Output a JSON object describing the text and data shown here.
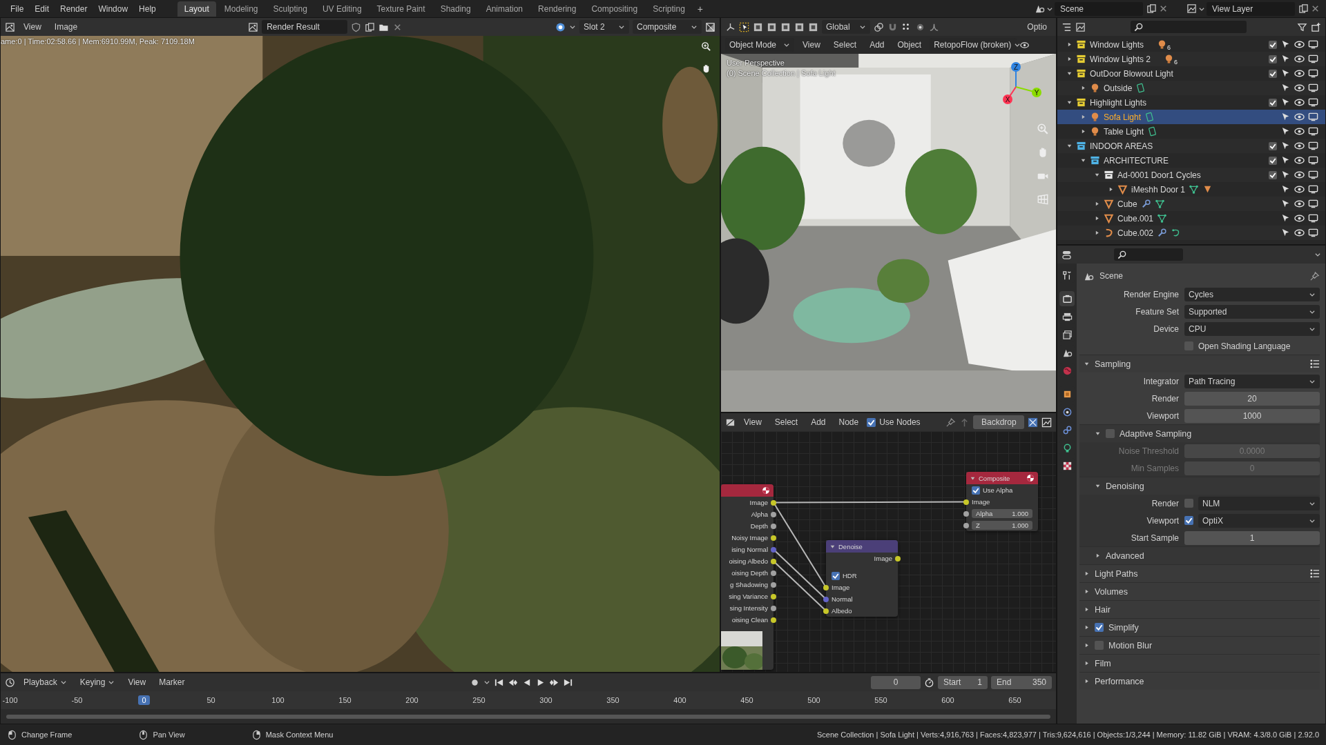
{
  "top_bar": {
    "menus": [
      "File",
      "Edit",
      "Render",
      "Window",
      "Help"
    ],
    "workspaces": [
      {
        "label": "Layout",
        "selected": true
      },
      {
        "label": "Modeling",
        "selected": false
      },
      {
        "label": "Sculpting",
        "selected": false
      },
      {
        "label": "UV Editing",
        "selected": false
      },
      {
        "label": "Texture Paint",
        "selected": false
      },
      {
        "label": "Shading",
        "selected": false
      },
      {
        "label": "Animation",
        "selected": false
      },
      {
        "label": "Rendering",
        "selected": false
      },
      {
        "label": "Compositing",
        "selected": false
      },
      {
        "label": "Scripting",
        "selected": false
      }
    ],
    "add_workspace": "+",
    "scene": "Scene",
    "view_layer": "View Layer"
  },
  "image_editor": {
    "menus": [
      "View",
      "Image"
    ],
    "image": "Render Result",
    "slot": "Slot 2",
    "layer": "Composite",
    "render_info": "ame:0 | Time:02:58.66 | Mem:6910.99M, Peak: 7109.18M"
  },
  "viewport": {
    "transform": "Global",
    "options": "Optio",
    "mode": "Object Mode",
    "menus": [
      "View",
      "Select",
      "Add",
      "Object"
    ],
    "addon_menu": "RetopoFlow (broken)",
    "view_name": "User Perspective",
    "context": "(0) Scene Collection | Sofa Light",
    "axes": [
      {
        "label": "Z",
        "color": "#2f83e0"
      },
      {
        "label": "Y",
        "color": "#8bdc00"
      },
      {
        "label": "X",
        "color": "#ff3352"
      }
    ]
  },
  "node_editor": {
    "menus": [
      "View",
      "Select",
      "Add",
      "Node"
    ],
    "use_nodes": {
      "label": "Use Nodes",
      "checked": true
    },
    "backdrop": "Backdrop",
    "nodes": [
      {
        "kind": "input",
        "preview": true,
        "rows": [
          {
            "kind": "output",
            "label": "Image",
            "color": "#c7c729"
          },
          {
            "kind": "output",
            "label": "Alpha",
            "color": "#a1a1a1"
          },
          {
            "kind": "output",
            "label": "Depth",
            "color": "#a1a1a1"
          },
          {
            "kind": "output",
            "label": "Noisy Image",
            "color": "#c7c729"
          },
          {
            "kind": "output",
            "label": "ising Normal",
            "color": "#6363c7"
          },
          {
            "kind": "output",
            "label": "oising Albedo",
            "color": "#c7c729"
          },
          {
            "kind": "output",
            "label": "oising Depth",
            "color": "#a1a1a1"
          },
          {
            "kind": "output",
            "label": "g Shadowing",
            "color": "#a1a1a1"
          },
          {
            "kind": "output",
            "label": "sing Variance",
            "color": "#c7c729"
          },
          {
            "kind": "output",
            "label": "sing Intensity",
            "color": "#a1a1a1"
          },
          {
            "kind": "output",
            "label": "oising Clean",
            "color": "#c7c729"
          }
        ]
      },
      {
        "kind": "filter",
        "title": "Denoise",
        "rows": [
          {
            "kind": "output",
            "label": "Image",
            "color": "#c7c729"
          },
          {
            "kind": "checkbox",
            "label": "HDR",
            "checked": true
          },
          {
            "kind": "input",
            "label": "Image",
            "color": "#c7c729",
            "linked": true
          },
          {
            "kind": "input",
            "label": "Normal",
            "color": "#6363c7",
            "linked": true
          },
          {
            "kind": "input",
            "label": "Albedo",
            "color": "#c7c729",
            "linked": true
          }
        ]
      },
      {
        "kind": "output",
        "title": "Composite",
        "rows": [
          {
            "kind": "checkbox",
            "label": "Use Alpha",
            "checked": true
          },
          {
            "kind": "input",
            "label": "Image",
            "color": "#c7c729",
            "linked": true
          },
          {
            "kind": "value",
            "label": "Alpha",
            "value": "1.000",
            "color": "#a1a1a1",
            "linked": false
          },
          {
            "kind": "value",
            "label": "Z",
            "value": "1.000",
            "color": "#a1a1a1",
            "linked": false
          }
        ]
      }
    ]
  },
  "outliner": {
    "items": [
      {
        "label": "Window Lights",
        "kind": "collection",
        "color": "#e5cc33",
        "badge": "6",
        "expanded": false,
        "checked": true,
        "selected": false
      },
      {
        "label": "Window Lights 2",
        "kind": "collection",
        "color": "#e5cc33",
        "badge": "6",
        "expanded": false,
        "checked": true,
        "selected": false
      },
      {
        "label": "OutDoor Blowout Light",
        "kind": "collection",
        "color": "#e5cc33",
        "expanded": true,
        "checked": true,
        "selected": false,
        "children": [
          {
            "label": "Outside",
            "kind": "light",
            "expanded": false,
            "selected": false
          }
        ]
      },
      {
        "label": "Highlight Lights",
        "kind": "collection",
        "color": "#e5cc33",
        "expanded": true,
        "checked": true,
        "selected": false,
        "children": [
          {
            "label": "Sofa Light",
            "kind": "light",
            "expanded": false,
            "selected": true
          },
          {
            "label": "Table Light",
            "kind": "light",
            "expanded": false,
            "selected": false
          }
        ]
      },
      {
        "label": "INDOOR AREAS",
        "kind": "collection",
        "color": "#4fb3e6",
        "expanded": true,
        "checked": true,
        "selected": false,
        "children": [
          {
            "label": "ARCHITECTURE",
            "kind": "collection",
            "color": "#4fb3e6",
            "expanded": true,
            "checked": true,
            "selected": false,
            "children": [
              {
                "label": "Ad-0001 Door1 Cycles",
                "kind": "collection",
                "color": "#e6e6e6",
                "expanded": true,
                "checked": true,
                "selected": false,
                "children": [
                  {
                    "label": "iMeshh Door 1",
                    "kind": "mesh",
                    "expanded": false,
                    "selected": false,
                    "modifiers": false,
                    "material": true
                  }
                ]
              },
              {
                "label": "Cube",
                "kind": "mesh",
                "expanded": false,
                "selected": false,
                "modifiers": true,
                "material": false
              },
              {
                "label": "Cube.001",
                "kind": "mesh",
                "expanded": false,
                "selected": false,
                "modifiers": false,
                "material": false
              },
              {
                "label": "Cube.002",
                "kind": "curve",
                "expanded": false,
                "selected": false,
                "modifiers": true,
                "material": false
              }
            ]
          }
        ]
      }
    ]
  },
  "properties": {
    "tabs": [
      {
        "kind": "tool",
        "selected": false
      },
      {
        "kind": "render",
        "selected": true
      },
      {
        "kind": "output",
        "selected": false
      },
      {
        "kind": "view_layer",
        "selected": false
      },
      {
        "kind": "scene",
        "selected": false
      },
      {
        "kind": "world",
        "selected": false
      },
      {
        "kind": "object",
        "selected": false
      },
      {
        "kind": "physics",
        "selected": false
      },
      {
        "kind": "constraints",
        "selected": false
      },
      {
        "kind": "data",
        "selected": false
      },
      {
        "kind": "texture",
        "selected": false
      }
    ],
    "context": "Scene",
    "rows": [
      {
        "kind": "dropdown",
        "label": "Render Engine",
        "value": "Cycles"
      },
      {
        "kind": "dropdown",
        "label": "Feature Set",
        "value": "Supported"
      },
      {
        "kind": "dropdown",
        "label": "Device",
        "value": "CPU"
      },
      {
        "kind": "checkbox",
        "label": "Open Shading Language",
        "checked": false
      }
    ],
    "panels": [
      {
        "title": "Sampling",
        "expanded": true,
        "presets": true,
        "rows": [
          {
            "kind": "dropdown",
            "label": "Integrator",
            "value": "Path Tracing"
          },
          {
            "kind": "number",
            "label": "Render",
            "value": "20"
          },
          {
            "kind": "number",
            "label": "Viewport",
            "value": "1000"
          }
        ],
        "subpanels": [
          {
            "title": "Adaptive Sampling",
            "expanded": true,
            "checked": false,
            "rows": [
              {
                "kind": "number",
                "label": "Noise Threshold",
                "value": "0.0000",
                "disabled": true
              },
              {
                "kind": "number",
                "label": "Min Samples",
                "value": "0",
                "disabled": true
              }
            ]
          },
          {
            "title": "Denoising",
            "expanded": true,
            "rows": [
              {
                "kind": "check_dropdown",
                "label": "Render",
                "checked": false,
                "value": "NLM"
              },
              {
                "kind": "check_dropdown",
                "label": "Viewport",
                "checked": true,
                "value": "OptiX"
              },
              {
                "kind": "number",
                "label": "Start Sample",
                "value": "1"
              }
            ]
          },
          {
            "title": "Advanced",
            "expanded": false
          }
        ]
      },
      {
        "title": "Light Paths",
        "expanded": false,
        "presets": true
      },
      {
        "title": "Volumes",
        "expanded": false
      },
      {
        "title": "Hair",
        "expanded": false
      },
      {
        "title": "Simplify",
        "expanded": false,
        "checked": true
      },
      {
        "title": "Motion Blur",
        "expanded": false,
        "checked": false
      },
      {
        "title": "Film",
        "expanded": false
      },
      {
        "title": "Performance",
        "expanded": false
      }
    ]
  },
  "timeline": {
    "menus": [
      "Playback",
      "Keying"
    ],
    "plain_menus": [
      "View",
      "Marker"
    ],
    "frame": "0",
    "start_label": "Start",
    "start": "1",
    "end_label": "End",
    "end": "350",
    "ruler": [
      {
        "label": "-100",
        "selected": false
      },
      {
        "label": "-50",
        "selected": false
      },
      {
        "label": "0",
        "selected": true
      },
      {
        "label": "50",
        "selected": false
      },
      {
        "label": "100",
        "selected": false
      },
      {
        "label": "150",
        "selected": false
      },
      {
        "label": "200",
        "selected": false
      },
      {
        "label": "250",
        "selected": false
      },
      {
        "label": "300",
        "selected": false
      },
      {
        "label": "350",
        "selected": false
      },
      {
        "label": "400",
        "selected": false
      },
      {
        "label": "450",
        "selected": false
      },
      {
        "label": "500",
        "selected": false
      },
      {
        "label": "550",
        "selected": false
      },
      {
        "label": "600",
        "selected": false
      },
      {
        "label": "650",
        "selected": false
      }
    ]
  },
  "status_bar": {
    "hints": [
      {
        "kind": "left",
        "label": "Change Frame"
      },
      {
        "kind": "middle",
        "label": "Pan View"
      },
      {
        "kind": "right",
        "label": "Mask Context Menu"
      }
    ],
    "stats": "Scene Collection | Sofa Light | Verts:4,916,763 | Faces:4,823,977 | Tris:9,624,616 | Objects:1/3,244 | Memory: 11.82 GiB | VRAM: 4.3/8.0 GiB | 2.92.0"
  }
}
